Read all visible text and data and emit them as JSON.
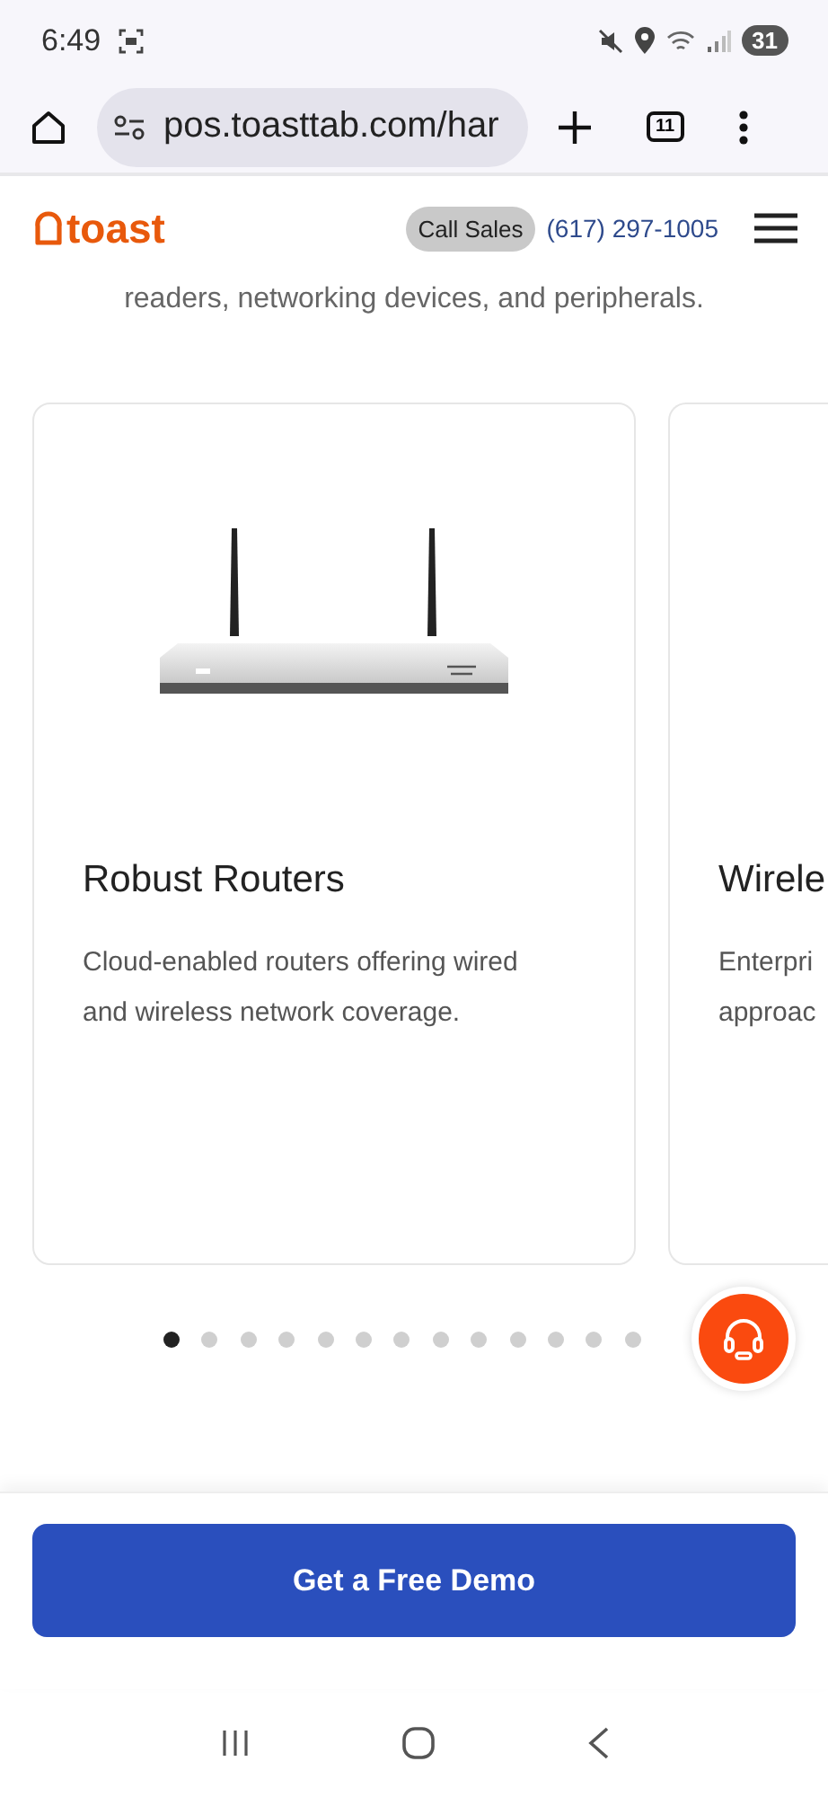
{
  "status_bar": {
    "time": "6:49",
    "battery": "31"
  },
  "browser": {
    "url": "pos.toasttab.com/har",
    "tab_count": "11"
  },
  "header": {
    "logo": "toast",
    "call_sales": "Call Sales",
    "phone": "(617) 297-1005"
  },
  "intro": "readers, networking devices, and peripherals.",
  "cards": [
    {
      "kind": "full",
      "title": "Robust Routers",
      "body": [
        "Cloud-enabled routers offering wired",
        "and wireless network coverage."
      ]
    },
    {
      "kind": "partial",
      "title": "Wirele",
      "body": [
        "Enterpri",
        "approac"
      ]
    }
  ],
  "dots": [
    {
      "selected": true
    },
    {
      "selected": false
    },
    {
      "selected": false
    },
    {
      "selected": false
    },
    {
      "selected": false
    },
    {
      "selected": false
    },
    {
      "selected": false
    },
    {
      "selected": false
    },
    {
      "selected": false
    },
    {
      "selected": false
    },
    {
      "selected": false
    },
    {
      "selected": false
    },
    {
      "selected": false
    }
  ],
  "cta": "Get a Free Demo"
}
